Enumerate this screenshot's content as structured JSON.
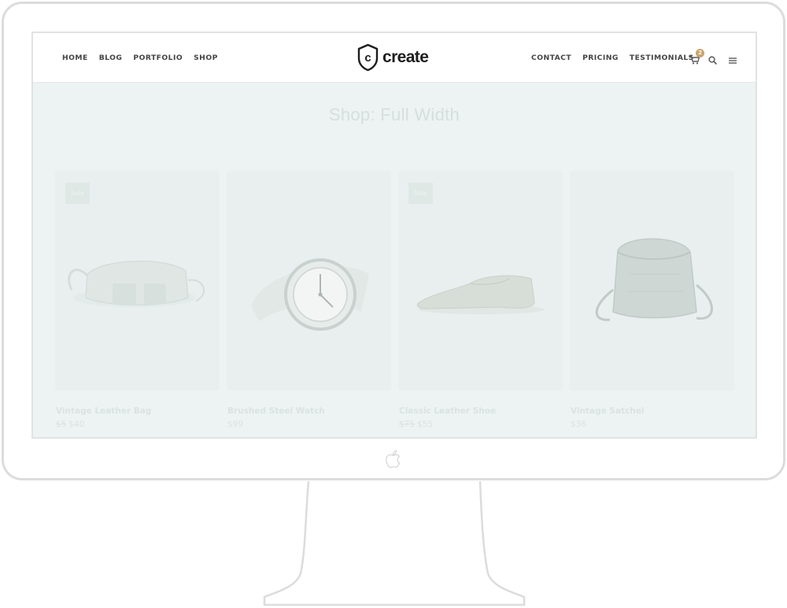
{
  "header": {
    "nav_left": [
      "HOME",
      "BLOG",
      "PORTFOLIO",
      "SHOP"
    ],
    "nav_right": [
      "CONTACT",
      "PRICING",
      "TESTIMONIALS"
    ],
    "logo_letter": "c",
    "logo_text": "create",
    "cart_count": "2"
  },
  "page": {
    "title": "Shop: Full Width"
  },
  "products": [
    {
      "name": "Vintage Leather Bag",
      "old_price": "$5",
      "price": "$40",
      "badge": "Sale"
    },
    {
      "name": "Brushed Steel Watch",
      "old_price": "",
      "price": "$99",
      "badge": ""
    },
    {
      "name": "Classic Leather Shoe",
      "old_price": "$75",
      "price": "$55",
      "badge": "Sale"
    },
    {
      "name": "Vintage Satchel",
      "old_price": "",
      "price": "$36",
      "badge": ""
    }
  ],
  "icons": {
    "cart": "cart-icon",
    "search": "search-icon",
    "menu": "hamburger-menu-icon",
    "brand": "apple-logo-icon"
  },
  "colors": {
    "screen_bg": "#ecf3f2",
    "badge_accent": "#c9a46e",
    "nav_text": "#444444"
  }
}
